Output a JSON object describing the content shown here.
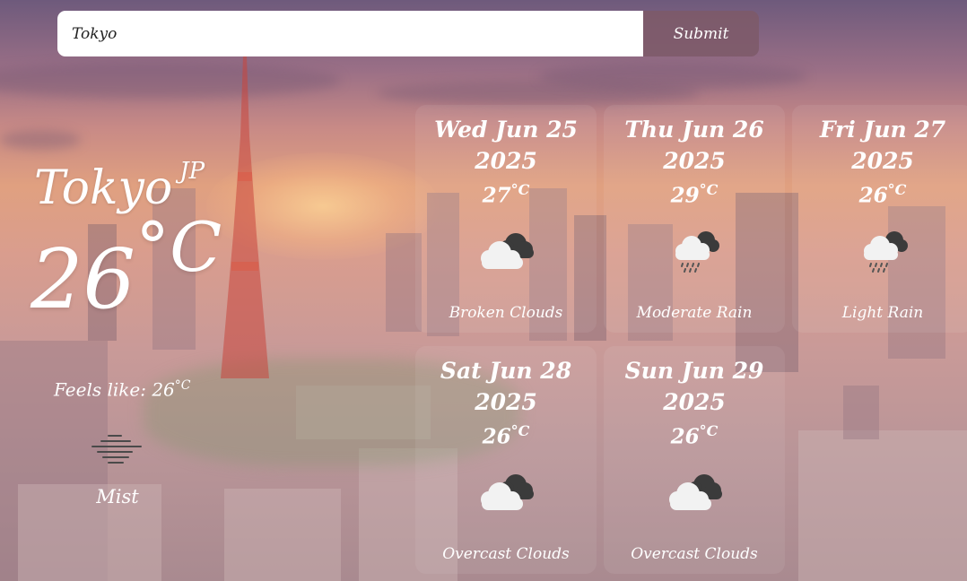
{
  "search": {
    "value": "Tokyo",
    "submit_label": "Submit"
  },
  "current": {
    "city": "Tokyo",
    "country": "JP",
    "temperature": "26",
    "temp_unit": "°C",
    "feels_like_label": "Feels like: 26",
    "feels_like_unit": "°C",
    "condition": "Mist",
    "icon": "mist-icon"
  },
  "forecast": [
    {
      "day": "Wed Jun 25",
      "year": "2025",
      "temp": "27",
      "unit": "°C",
      "description": "Broken Clouds",
      "icon": "broken-clouds-icon"
    },
    {
      "day": "Thu Jun 26",
      "year": "2025",
      "temp": "29",
      "unit": "°C",
      "description": "Moderate Rain",
      "icon": "rain-icon"
    },
    {
      "day": "Fri Jun 27",
      "year": "2025",
      "temp": "26",
      "unit": "°C",
      "description": "Light Rain",
      "icon": "rain-icon"
    },
    {
      "day": "Sat Jun 28",
      "year": "2025",
      "temp": "26",
      "unit": "°C",
      "description": "Overcast Clouds",
      "icon": "overcast-clouds-icon"
    },
    {
      "day": "Sun Jun 29",
      "year": "2025",
      "temp": "26",
      "unit": "°C",
      "description": "Overcast Clouds",
      "icon": "overcast-clouds-icon"
    }
  ]
}
